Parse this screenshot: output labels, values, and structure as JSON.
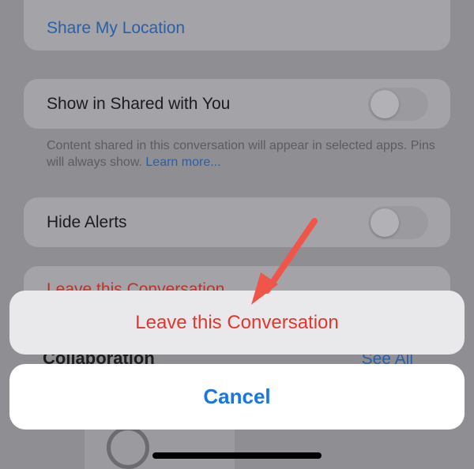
{
  "settings": {
    "share_location": "Share My Location",
    "shared_with_you": {
      "label": "Show in Shared with You",
      "enabled": false
    },
    "footnote": "Content shared in this conversation will appear in selected apps. Pins will always show.",
    "learn_more": "Learn more...",
    "hide_alerts": {
      "label": "Hide Alerts",
      "enabled": false
    },
    "leave_row_label": "Leave this Conversation",
    "collaboration_heading": "Collaboration",
    "see_all": "See All"
  },
  "action_sheet": {
    "leave_label": "Leave this Conversation",
    "cancel_label": "Cancel"
  },
  "colors": {
    "destructive": "#e2372c",
    "accent": "#1677e8",
    "annotation_arrow": "#f0554a"
  }
}
